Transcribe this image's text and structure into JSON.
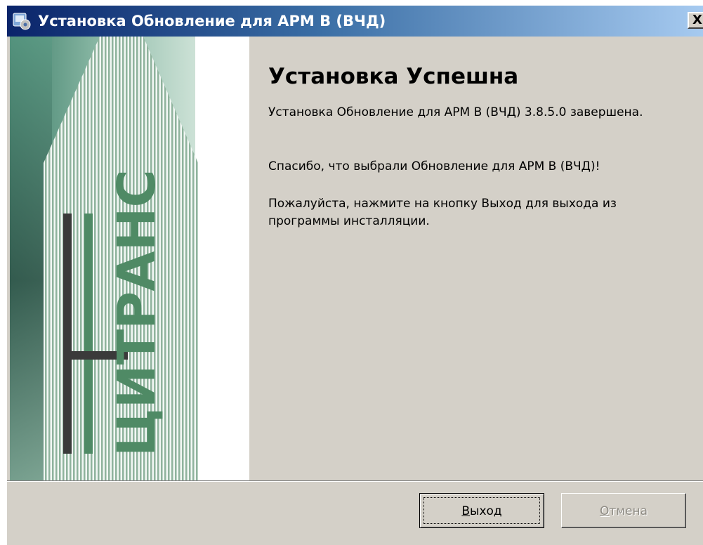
{
  "window": {
    "title": "Установка Обновление для АРМ В (ВЧД)",
    "close_label": "X"
  },
  "side_panel": {
    "logo_text": "ЦИТРАНС",
    "colors": {
      "green": "#4f8a65",
      "dark": "#3a3a3a",
      "stripe": "#9ab8a6"
    }
  },
  "content": {
    "heading": "Установка Успешна",
    "paragraph1": "Установка Обновление для АРМ В (ВЧД) 3.8.5.0 завершена.",
    "paragraph2": "Спасибо, что выбрали Обновление для АРМ В (ВЧД)!",
    "paragraph3": "Пожалуйста, нажмите на кнопку Выход для выхода из программы инсталляции."
  },
  "buttons": {
    "exit": {
      "mnemonic": "В",
      "rest": "ыход",
      "enabled": true
    },
    "cancel": {
      "mnemonic": "О",
      "rest": "тмена",
      "enabled": false
    }
  }
}
